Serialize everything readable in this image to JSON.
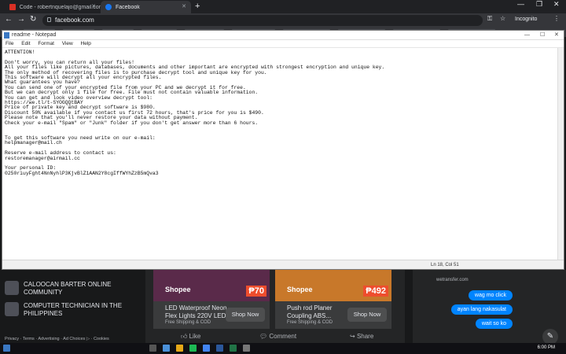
{
  "browser": {
    "tabs": [
      {
        "label": "Code - robertnquelajo@gmail.com"
      },
      {
        "label": "Facebook"
      }
    ],
    "url": "facebook.com",
    "profile": "Incognito"
  },
  "notepad": {
    "title": "readme - Notepad",
    "menu": [
      "File",
      "Edit",
      "Format",
      "View",
      "Help"
    ],
    "body": "ATTENTION!\n\nDon't worry, you can return all your files!\nAll your files like pictures, databases, documents and other important are encrypted with strongest encryption and unique key.\nThe only method of recovering files is to purchase decrypt tool and unique key for you.\nThis software will decrypt all your encrypted files.\nWhat guarantees you have?\nYou can send one of your encrypted file from your PC and we decrypt it for free.\nBut we can decrypt only 1 file for free. File must not contain valuable information.\nYou can get and look video overview decrypt tool:\nhttps://we.tl/t-SYOGQQtBAY\nPrice of private key and decrypt software is $980.\nDiscount 50% available if you contact us first 72 hours, that's price for you is $490.\nPlease note that you'll never restore your data without payment.\nCheck your e-mail \"Spam\" or \"Junk\" folder if you don't get answer more than 6 hours.\n\n\nTo get this software you need write on our e-mail:\nhelpmanager@mail.ch\n\nReserve e-mail address to contact us:\nrestoremanager@airmail.cc\n\nYour personal ID:\n0250riuyFght4NnNyhlP3KjvBlZ1AAN2Y8cgIffWYhZzB5mQva3",
    "status": "Ln 18, Col 51"
  },
  "facebook": {
    "sidebar": [
      {
        "label": "CALOOCAN BARTER ONLINE COMMUNITY"
      },
      {
        "label": "COMPUTER TECHNICIAN IN THE PHILIPPINES"
      }
    ],
    "footer": "Privacy · Terms · Advertising · Ad Choices ▷ · Cookies",
    "ads": [
      {
        "brand": "Shopee",
        "price": "₱70",
        "name": "LED Waterproof Neon Flex Lights 220V LED...",
        "shipping": "Free Shipping & COD",
        "cta": "Shop Now"
      },
      {
        "brand": "Shopee",
        "price": "₱492",
        "name": "Push rod Planer Coupling ABS...",
        "shipping": "Free Shipping & COD",
        "cta": "Shop Now"
      }
    ],
    "actions": {
      "like": "Like",
      "comment": "Comment",
      "share": "Share"
    },
    "chat": {
      "link": "wetransfer.com",
      "messages": [
        "wag mo click",
        "ayan lang nakasulat",
        "wait so ko"
      ]
    }
  },
  "taskbar": {
    "time": "6:00 PM"
  }
}
